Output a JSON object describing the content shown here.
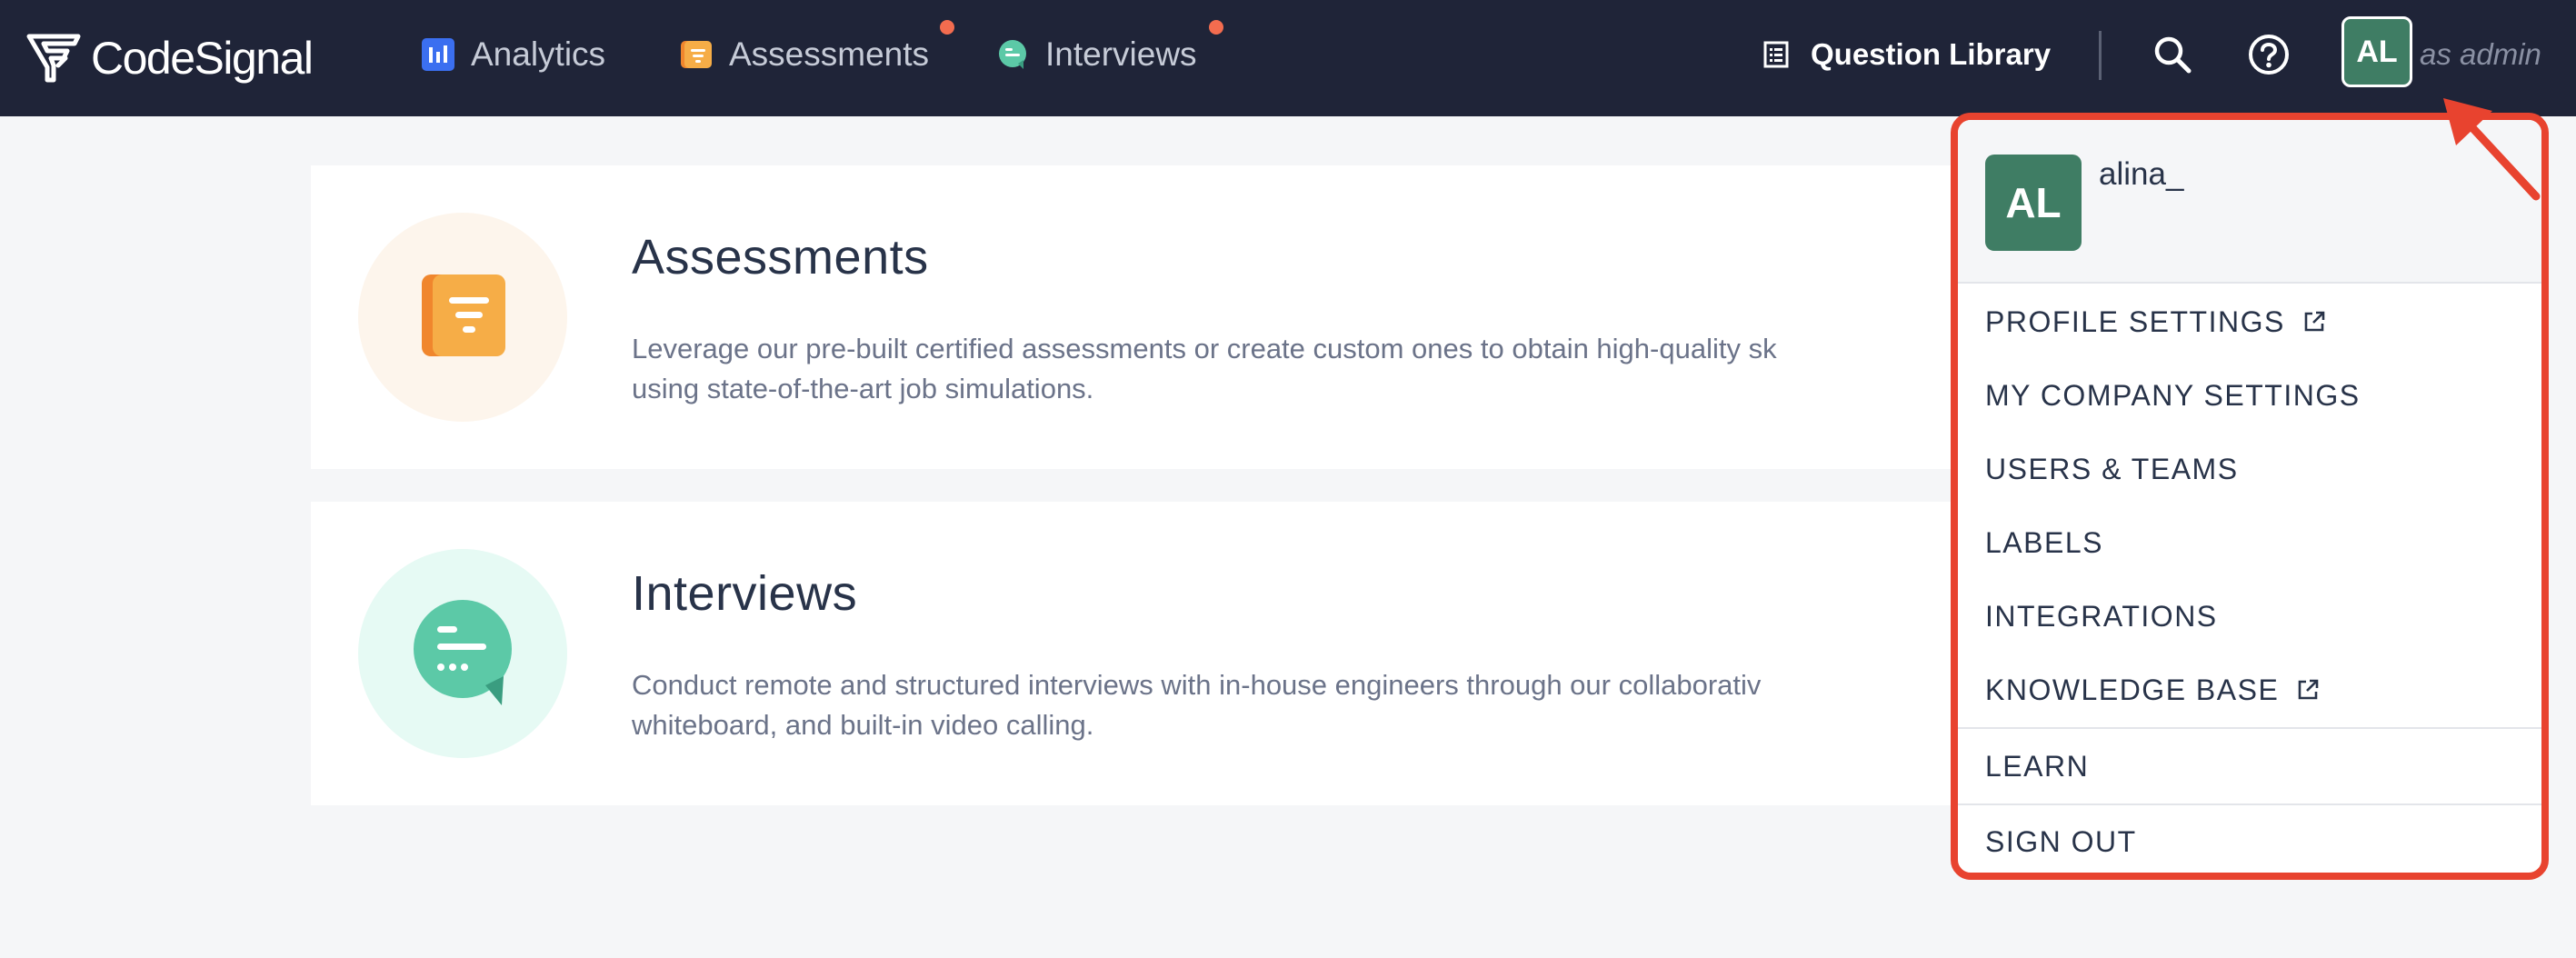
{
  "nav": {
    "logo": "CodeSignal",
    "items": [
      {
        "label": "Analytics",
        "icon": "analytics-icon",
        "color": "#3b6ff0",
        "has_dot": false
      },
      {
        "label": "Assessments",
        "icon": "assessments-icon",
        "color": "#f2a23a",
        "has_dot": true
      },
      {
        "label": "Interviews",
        "icon": "interviews-icon",
        "color": "#5cc9a7",
        "has_dot": true
      }
    ],
    "question_library": "Question Library",
    "search_icon": "search-icon",
    "help_icon": "help-icon",
    "avatar_initials": "AL",
    "role_text": "as admin",
    "dot_color": "#f36c4f"
  },
  "cards": [
    {
      "title": "Assessments",
      "desc_line1": "Leverage our pre-built certified assessments or create custom ones to obtain high-quality sk",
      "desc_line2": "using state-of-the-art job simulations.",
      "icon": "assessments-icon"
    },
    {
      "title": "Interviews",
      "desc_line1": "Conduct remote and structured interviews with in-house engineers through our collaborativ",
      "desc_line2": "whiteboard, and built-in video calling.",
      "icon": "interviews-icon"
    }
  ],
  "dropdown": {
    "avatar_initials": "AL",
    "user_name": "alina_",
    "items": [
      {
        "label": "PROFILE SETTINGS",
        "external": true
      },
      {
        "label": "MY COMPANY SETTINGS",
        "external": false
      },
      {
        "label": "USERS & TEAMS",
        "external": false
      },
      {
        "label": "LABELS",
        "external": false
      },
      {
        "label": "INTEGRATIONS",
        "external": false
      },
      {
        "label": "KNOWLEDGE BASE",
        "external": true
      },
      {
        "label": "LEARN",
        "external": false
      },
      {
        "label": "SIGN OUT",
        "external": false
      }
    ],
    "highlight_color": "#e8432f"
  }
}
